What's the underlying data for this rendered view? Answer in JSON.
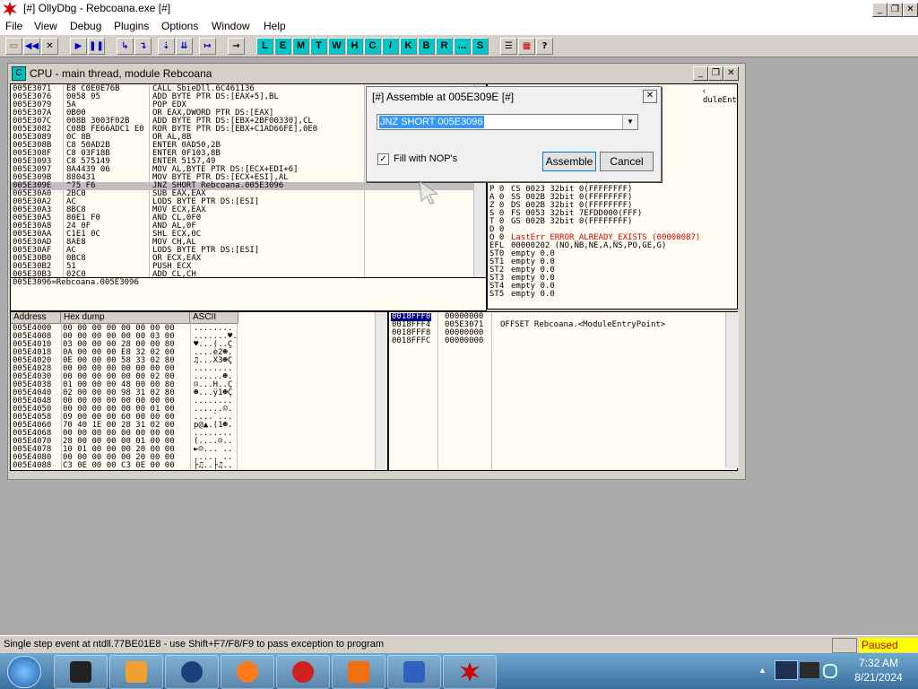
{
  "window": {
    "title": "[#] OllyDbg - Rebcoana.exe [#]"
  },
  "menu": [
    "File",
    "View",
    "Debug",
    "Plugins",
    "Options",
    "Window",
    "Help"
  ],
  "toolbar": {
    "letters": [
      "L",
      "E",
      "M",
      "T",
      "W",
      "H",
      "C",
      "/",
      "K",
      "B",
      "R",
      "...",
      "S"
    ]
  },
  "cpu": {
    "title": "CPU - main thread, module Rebcoana",
    "disasm_rows": [
      [
        "005E3071",
        "E8 C0E0E76B",
        "CALL SbieDll.6C461136"
      ],
      [
        "005E3076",
        "0058 05",
        "ADD BYTE PTR DS:[EAX+5],BL"
      ],
      [
        "005E3079",
        "5A",
        "POP EDX"
      ],
      [
        "005E307A",
        "0B00",
        "OR EAX,DWORD PTR DS:[EAX]"
      ],
      [
        "005E307C",
        "008B 3003F02B",
        "ADD BYTE PTR DS:[EBX+2BF00330],CL"
      ],
      [
        "005E3082",
        "C08B FE66ADC1 E0",
        "ROR BYTE PTR DS:[EBX+C1AD66FE],0E0"
      ],
      [
        "005E3089",
        "0C 8B",
        "OR AL,8B"
      ],
      [
        "005E308B",
        "C8 50AD2B",
        "ENTER 0AD50,2B"
      ],
      [
        "005E308F",
        "C8 03F18B",
        "ENTER 0F103,8B"
      ],
      [
        "005E3093",
        "C8 575149",
        "ENTER 5157,49"
      ],
      [
        "005E3097",
        "8A4439 06",
        "MOV AL,BYTE PTR DS:[ECX+EDI+6]"
      ],
      [
        "005E309B",
        "880431",
        "MOV BYTE PTR DS:[ECX+ESI],AL"
      ],
      [
        "005E309E",
        "^75 F6",
        "JNZ SHORT Rebcoana.005E3096"
      ],
      [
        "005E30A0",
        "2BC0",
        "SUB EAX,EAX"
      ],
      [
        "005E30A2",
        "AC",
        "LODS BYTE PTR DS:[ESI]"
      ],
      [
        "005E30A3",
        "8BC8",
        "MOV ECX,EAX"
      ],
      [
        "005E30A5",
        "80E1 F0",
        "AND CL,0F0"
      ],
      [
        "005E30A8",
        "24 0F",
        "AND AL,0F"
      ],
      [
        "005E30AA",
        "C1E1 0C",
        "SHL ECX,0C"
      ],
      [
        "005E30AD",
        "8AE8",
        "MOV CH,AL"
      ],
      [
        "005E30AF",
        "AC",
        "LODS BYTE PTR DS:[ESI]"
      ],
      [
        "005E30B0",
        "0BC8",
        "OR ECX,EAX"
      ],
      [
        "005E30B2",
        "51",
        "PUSH ECX"
      ],
      [
        "005E30B3",
        "02C0",
        "ADD CL,CH"
      ]
    ],
    "selected_row": 12,
    "info_line": "005E3096=Rebcoana.005E3096",
    "regs_top_label": "duleEntryPoint",
    "registers": [
      [
        "C 0",
        "ES 002B 32bit 0(FFFFFFFF)"
      ],
      [
        "P 0",
        "CS 0023 32bit 0(FFFFFFFF)"
      ],
      [
        "A 0",
        "SS 002B 32bit 0(FFFFFFFF)"
      ],
      [
        "Z 0",
        "DS 002B 32bit 0(FFFFFFFF)"
      ],
      [
        "S 0",
        "FS 0053 32bit 7EFDD000(FFF)"
      ],
      [
        "T 0",
        "GS 002B 32bit 0(FFFFFFFF)"
      ],
      [
        "D 0",
        ""
      ],
      [
        "O 0",
        "LastErr ERROR_ALREADY_EXISTS (000000B7)"
      ],
      [
        "EFL",
        "00000202 (NO,NB,NE,A,NS,PO,GE,G)"
      ],
      [
        "ST0",
        "empty 0.0"
      ],
      [
        "ST1",
        "empty 0.0"
      ],
      [
        "ST2",
        "empty 0.0"
      ],
      [
        "ST3",
        "empty 0.0"
      ],
      [
        "ST4",
        "empty 0.0"
      ],
      [
        "ST5",
        "empty 0.0"
      ]
    ],
    "dump_headers": [
      "Address",
      "Hex dump",
      "ASCII"
    ],
    "dump_rows": [
      [
        "005E4000",
        "00 00 00 00 00 00 00 00",
        "........"
      ],
      [
        "005E4008",
        "00 00 00 00 00 00 03 00",
        ".......♥."
      ],
      [
        "005E4010",
        "03 00 00 00 28 00 00 80",
        "♥...(..Ç"
      ],
      [
        "005E4018",
        "0A 00 00 00 E8 32 02 00",
        "....è2☻."
      ],
      [
        "005E4020",
        "0E 00 00 00 58 33 02 80",
        "♫...X3☻Ç"
      ],
      [
        "005E4028",
        "00 00 00 00 00 00 00 00",
        "........"
      ],
      [
        "005E4030",
        "00 00 00 00 00 00 02 00",
        "......☻."
      ],
      [
        "005E4038",
        "01 00 00 00 48 00 00 80",
        "☺...H..Ç"
      ],
      [
        "005E4040",
        "02 00 00 00 98 31 02 80",
        "☻...ÿ1☻Ç"
      ],
      [
        "005E4048",
        "00 00 00 00 00 00 00 00",
        "........"
      ],
      [
        "005E4050",
        "00 00 00 00 00 00 01 00",
        "......☺."
      ],
      [
        "005E4058",
        "09 00 00 00 60 00 00 00",
        "....`..."
      ],
      [
        "005E4060",
        "70 40 1E 00 28 31 02 00",
        "p@▲.(1☻."
      ],
      [
        "005E4068",
        "00 00 00 00 00 00 00 00",
        "........"
      ],
      [
        "005E4070",
        "28 00 00 00 00 01 00 00",
        "(....☺.."
      ],
      [
        "005E4078",
        "10 01 00 00 00 20 00 00",
        "►☺... .."
      ],
      [
        "005E4080",
        "00 00 00 00 00 20 00 00",
        "..... .."
      ],
      [
        "005E4088",
        "C3 0E 00 00 C3 0E 00 00",
        "├♫..├♫.."
      ]
    ],
    "stack_rows": [
      [
        "0018FFF0",
        "00000000",
        ""
      ],
      [
        "0018FFF4",
        "005E3071",
        "OFFSET Rebcoana.<ModuleEntryPoint>"
      ],
      [
        "0018FFF8",
        "00000000",
        ""
      ],
      [
        "0018FFFC",
        "00000000",
        ""
      ]
    ],
    "stack_selected": 0
  },
  "dialog": {
    "title": "[#] Assemble at 005E309E [#]",
    "input_value": "JNZ SHORT 005E3096",
    "checkbox_label": "Fill with NOP's",
    "checkbox_checked": true,
    "assemble_label": "Assemble",
    "cancel_label": "Cancel"
  },
  "status": {
    "message": "Single step event at ntdll.77BE01E8 - use Shift+F7/F8/F9 to pass exception to program",
    "state": "Paused"
  },
  "clock": {
    "time": "7:32 AM",
    "date": "8/21/2024"
  },
  "taskbar_apps": [
    "task-manager-icon",
    "media-player-icon",
    "globe-icon",
    "firefox-icon",
    "debugger-icon",
    "vlc-icon",
    "app-icon",
    "ollydbg-icon"
  ],
  "colors": {
    "paused_bg": "#ffff00",
    "paused_text": "#c00000",
    "error_text": "#d00000",
    "selection_bar": "#c0c0c0"
  }
}
